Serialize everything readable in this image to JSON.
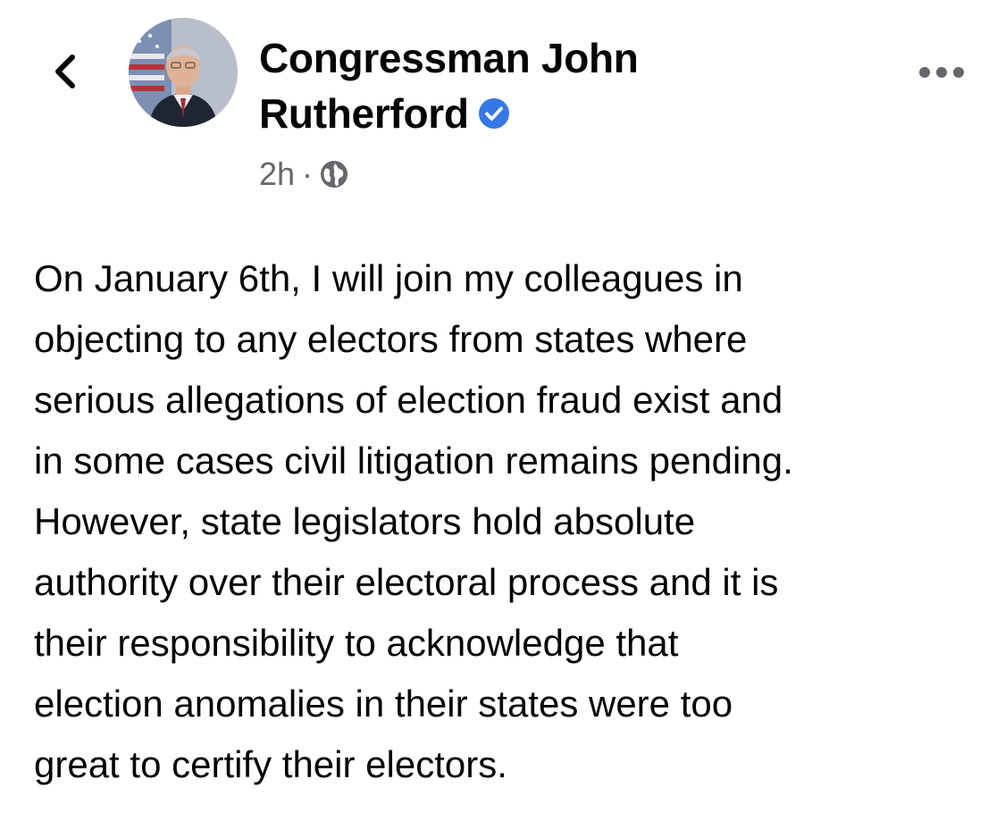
{
  "navigation": {
    "back_icon": "chevron-left-icon"
  },
  "post": {
    "author": {
      "name_line1": "Congressman John",
      "name_line2": "Rutherford",
      "verified": true,
      "verified_icon": "verified-badge-icon",
      "verified_color": "#3578e5"
    },
    "timestamp": "2h",
    "separator": "·",
    "audience_icon": "globe-icon",
    "more_icon": "more-options-icon",
    "body_lines": [
      "On January 6th, I will join my colleagues in",
      "objecting to any electors from states where",
      "serious allegations of election fraud exist and",
      "in some cases civil litigation remains pending.",
      "However, state legislators hold absolute",
      "authority over their electoral process and it is",
      "their responsibility to acknowledge that",
      "election anomalies in their states were too",
      "great to certify their electors."
    ]
  },
  "colors": {
    "text_primary": "#050505",
    "text_secondary": "#65676b",
    "background": "#ffffff"
  }
}
